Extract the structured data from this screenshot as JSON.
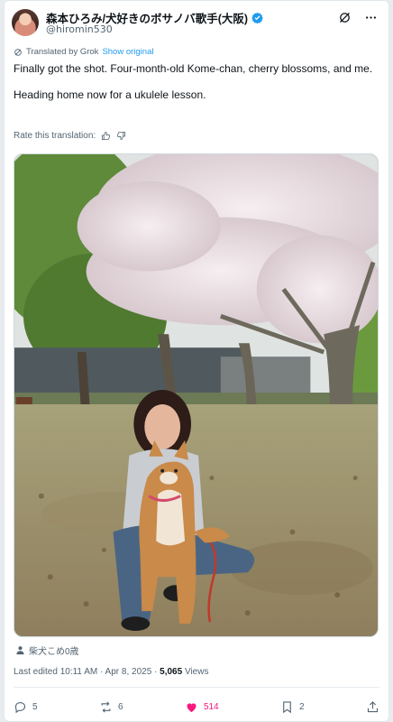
{
  "author": {
    "display_name": "森本ひろみ/犬好きのボサノバ歌手(大阪)",
    "handle": "@hiromin530"
  },
  "translation": {
    "label": "Translated by Grok",
    "show_original": "Show original"
  },
  "tweet": {
    "line1": "Finally got the shot. Four-month-old Kome-chan, cherry blossoms, and me.",
    "line2": "Heading home now for a ukulele lesson."
  },
  "rate": {
    "label": "Rate this translation:"
  },
  "location": {
    "label": "柴犬こめ0歳"
  },
  "meta": {
    "edited": "Last edited 10:11 AM · Apr 8, 2025 · ",
    "views_count": "5,065",
    "views_label": " Views"
  },
  "actions": {
    "replies": "5",
    "reposts": "6",
    "likes": "514",
    "bookmarks": "2"
  },
  "colors": {
    "accent": "#1d9bf0",
    "like": "#f91880",
    "muted": "#536471"
  },
  "icons": [
    "verified-badge-icon",
    "grok-icon",
    "more-icon",
    "translate-icon",
    "thumbs-up-icon",
    "thumbs-down-icon",
    "person-icon",
    "reply-icon",
    "repost-icon",
    "heart-icon",
    "bookmark-icon",
    "share-icon"
  ]
}
